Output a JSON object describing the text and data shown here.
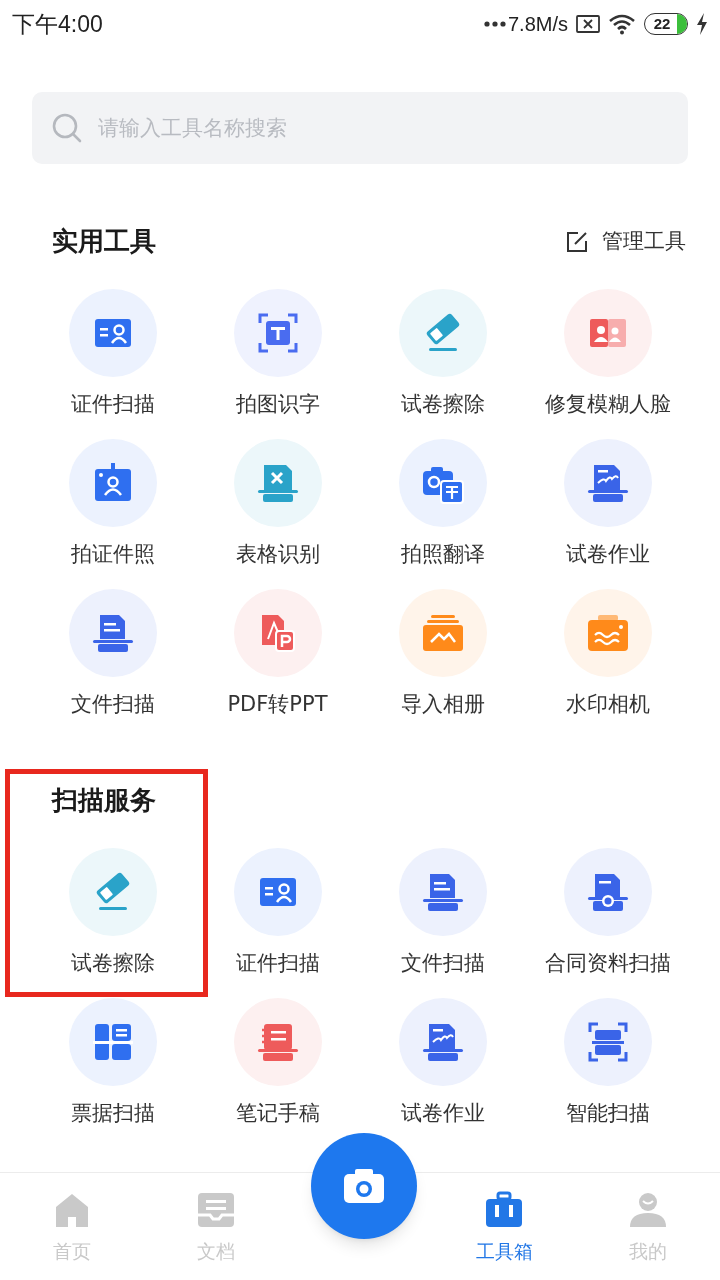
{
  "status_bar": {
    "time": "下午4:00",
    "network_speed": "7.8M/s",
    "battery": "22",
    "charging": true
  },
  "search": {
    "placeholder": "请输入工具名称搜索"
  },
  "practical_tools": {
    "title": "实用工具",
    "manage": "管理工具",
    "items": [
      {
        "label": "证件扫描",
        "kind": "id-card",
        "color": "#2f6ff0"
      },
      {
        "label": "拍图识字",
        "kind": "text-scan",
        "color": "#4a6cf0"
      },
      {
        "label": "试卷擦除",
        "kind": "eraser",
        "color": "#2aa3c9"
      },
      {
        "label": "修复模糊人脸",
        "kind": "face",
        "color": "#ee5b5b"
      },
      {
        "label": "拍证件照",
        "kind": "id-photo",
        "color": "#2f6ff0"
      },
      {
        "label": "表格识别",
        "kind": "table",
        "color": "#2aa3c9"
      },
      {
        "label": "拍照翻译",
        "kind": "translate",
        "color": "#2f6ff0"
      },
      {
        "label": "试卷作业",
        "kind": "homework",
        "color": "#3a64e8"
      },
      {
        "label": "文件扫描",
        "kind": "document",
        "color": "#3a64e8"
      },
      {
        "label": "PDF转PPT",
        "kind": "pdf",
        "color": "#ee5b5b"
      },
      {
        "label": "导入相册",
        "kind": "album",
        "color": "#ff8a1a"
      },
      {
        "label": "水印相机",
        "kind": "watermark",
        "color": "#ff8a1a"
      }
    ]
  },
  "scan_services": {
    "title": "扫描服务",
    "items": [
      {
        "label": "试卷擦除",
        "kind": "eraser",
        "color": "#2aa3c9",
        "highlighted": true
      },
      {
        "label": "证件扫描",
        "kind": "id-card",
        "color": "#2f6ff0",
        "highlighted": false
      },
      {
        "label": "文件扫描",
        "kind": "document",
        "color": "#3a64e8",
        "highlighted": false
      },
      {
        "label": "合同资料扫描",
        "kind": "contract",
        "color": "#3a64e8",
        "highlighted": false
      },
      {
        "label": "票据扫描",
        "kind": "receipt",
        "color": "#2f6ff0",
        "highlighted": false
      },
      {
        "label": "笔记手稿",
        "kind": "notes",
        "color": "#ee5b5b",
        "highlighted": false
      },
      {
        "label": "试卷作业",
        "kind": "homework",
        "color": "#3a64e8",
        "highlighted": false
      },
      {
        "label": "智能扫描",
        "kind": "smart-scan",
        "color": "#3a64e8",
        "highlighted": false
      }
    ]
  },
  "bottom_nav": {
    "items": [
      {
        "label": "首页",
        "kind": "home",
        "selected": false
      },
      {
        "label": "文档",
        "kind": "docs",
        "selected": false
      },
      {
        "kind": "camera",
        "selected": false
      },
      {
        "label": "工具箱",
        "kind": "toolbox",
        "selected": true
      },
      {
        "label": "我的",
        "kind": "profile",
        "selected": false
      }
    ]
  }
}
